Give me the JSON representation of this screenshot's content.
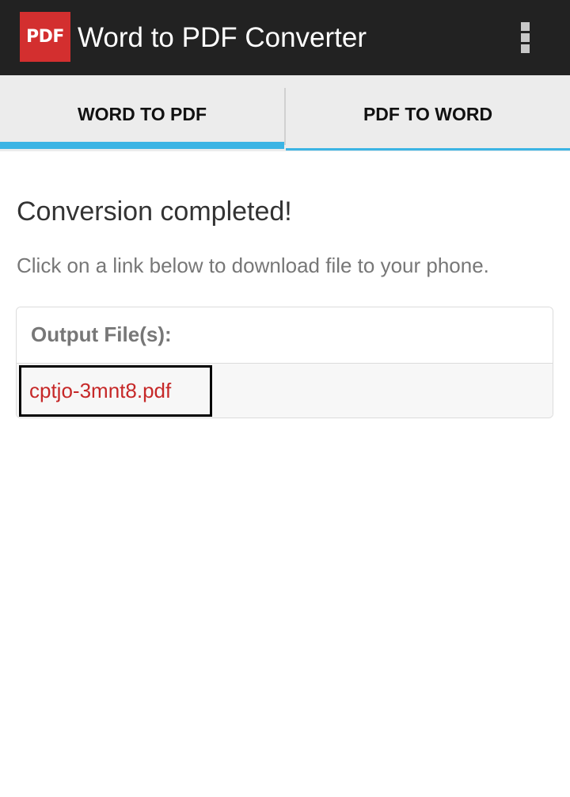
{
  "app_bar": {
    "logo_text": "PDF",
    "title": "Word to PDF Converter",
    "menu_icon": "overflow-menu-icon"
  },
  "tabs": [
    {
      "label": "WORD TO PDF",
      "selected": true
    },
    {
      "label": "PDF TO WORD",
      "selected": false
    }
  ],
  "main": {
    "heading": "Conversion completed!",
    "instruction": "Click on a link below to download file to your phone.",
    "output_panel": {
      "header": "Output File(s):",
      "files": [
        "cptjo-3mnt8.pdf"
      ]
    }
  },
  "colors": {
    "app_bar_bg": "#222222",
    "logo_bg": "#d32f2f",
    "tab_accent": "#3cb4e4",
    "link_color": "#c62828"
  }
}
